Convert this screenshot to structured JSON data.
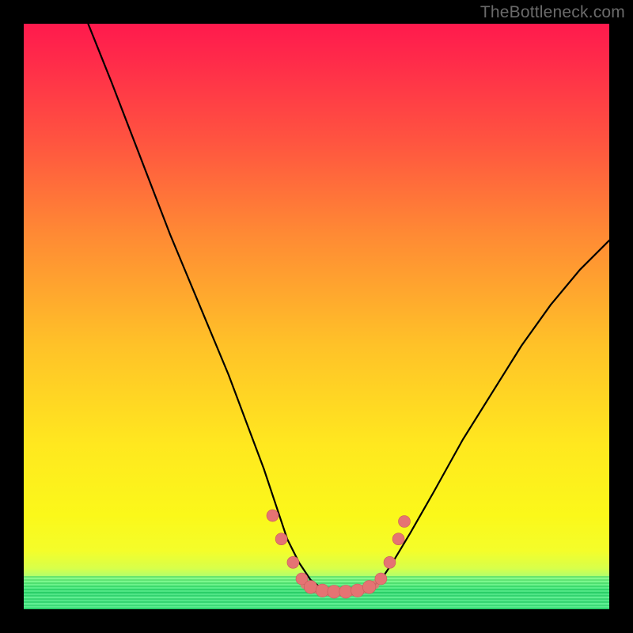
{
  "watermark": "TheBottleneck.com",
  "colors": {
    "frame": "#000000",
    "curve": "#000000",
    "marker_fill": "#e57373",
    "marker_stroke": "#c85a5a"
  },
  "chart_data": {
    "type": "line",
    "title": "",
    "xlabel": "",
    "ylabel": "",
    "xlim": [
      0,
      100
    ],
    "ylim": [
      0,
      100
    ],
    "grid": false,
    "note": "Axes have no tick labels in the image; x and y are normalized 0–100 estimates from pixel positions. y=0 at bottom, x=0 at left.",
    "series": [
      {
        "name": "curve",
        "x": [
          11,
          15,
          20,
          25,
          30,
          35,
          38,
          41,
          43,
          45,
          47,
          49,
          51,
          53,
          55,
          57,
          59,
          61,
          63,
          66,
          70,
          75,
          80,
          85,
          90,
          95,
          100
        ],
        "y": [
          100,
          90,
          77,
          64,
          52,
          40,
          32,
          24,
          18,
          12,
          8,
          5,
          3.5,
          3,
          3,
          3,
          3.5,
          5,
          8,
          13,
          20,
          29,
          37,
          45,
          52,
          58,
          63
        ]
      }
    ],
    "markers": [
      {
        "x": 42.5,
        "y": 16,
        "r": 1.1
      },
      {
        "x": 44.0,
        "y": 12,
        "r": 1.1
      },
      {
        "x": 46.0,
        "y": 8,
        "r": 1.1
      },
      {
        "x": 47.5,
        "y": 5.2,
        "r": 1.1
      },
      {
        "x": 49.0,
        "y": 3.8,
        "r": 1.3
      },
      {
        "x": 51.0,
        "y": 3.2,
        "r": 1.3
      },
      {
        "x": 53.0,
        "y": 3.0,
        "r": 1.3
      },
      {
        "x": 55.0,
        "y": 3.0,
        "r": 1.3
      },
      {
        "x": 57.0,
        "y": 3.2,
        "r": 1.3
      },
      {
        "x": 59.0,
        "y": 3.8,
        "r": 1.3
      },
      {
        "x": 61.0,
        "y": 5.2,
        "r": 1.1
      },
      {
        "x": 62.5,
        "y": 8,
        "r": 1.1
      },
      {
        "x": 64.0,
        "y": 12,
        "r": 1.1
      },
      {
        "x": 65.0,
        "y": 15,
        "r": 1.1
      }
    ]
  }
}
